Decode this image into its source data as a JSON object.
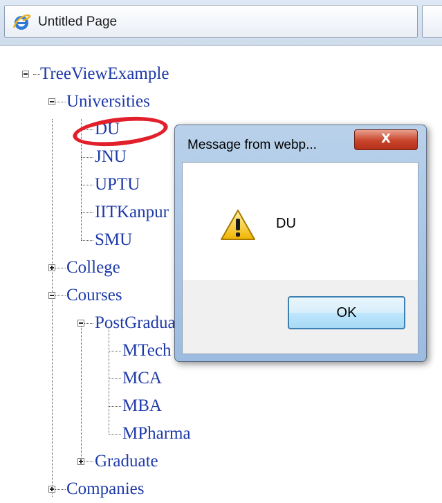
{
  "browser": {
    "tab_title": "Untitled Page",
    "tab_icon": "ie-icon"
  },
  "tree": {
    "root": "TreeViewExample",
    "universities": {
      "label": "Universities",
      "children": [
        "DU",
        "JNU",
        "UPTU",
        "IITKanpur",
        "SMU"
      ]
    },
    "college": "College",
    "courses": {
      "label": "Courses",
      "postgrad": {
        "label": "PostGraduate",
        "children": [
          "MTech",
          "MCA",
          "MBA",
          "MPharma"
        ]
      },
      "graduate": "Graduate"
    },
    "companies": "Companies"
  },
  "dialog": {
    "title": "Message from webp...",
    "close_label": "X",
    "message": "DU",
    "ok_label": "OK",
    "icon": "warning-icon"
  },
  "colors": {
    "link": "#1e3aa8",
    "highlight": "#e2202b"
  }
}
